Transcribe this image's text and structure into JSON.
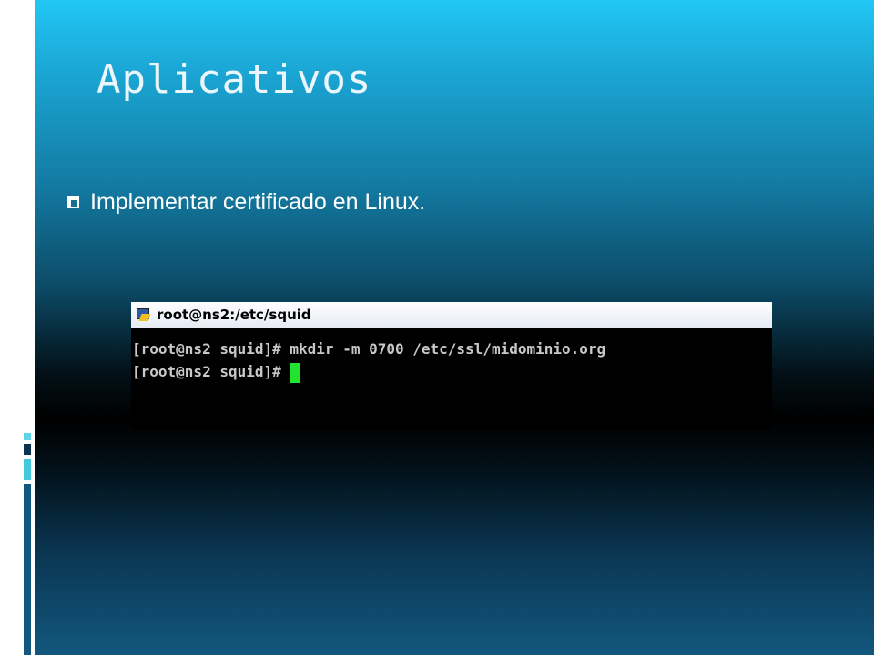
{
  "slide": {
    "title": "Aplicativos",
    "bullet": "Implementar certificado en Linux."
  },
  "terminal": {
    "title": "root@ns2:/etc/squid",
    "lines": [
      "[root@ns2 squid]# mkdir -m 0700 /etc/ssl/midominio.org",
      "[root@ns2 squid]# "
    ],
    "cursor_color": "#22e32e"
  },
  "colors": {
    "top_gradient": "#22c7f5",
    "mid_dark": "#000000",
    "bottom_gradient": "#12577e",
    "text": "#ffffff"
  }
}
